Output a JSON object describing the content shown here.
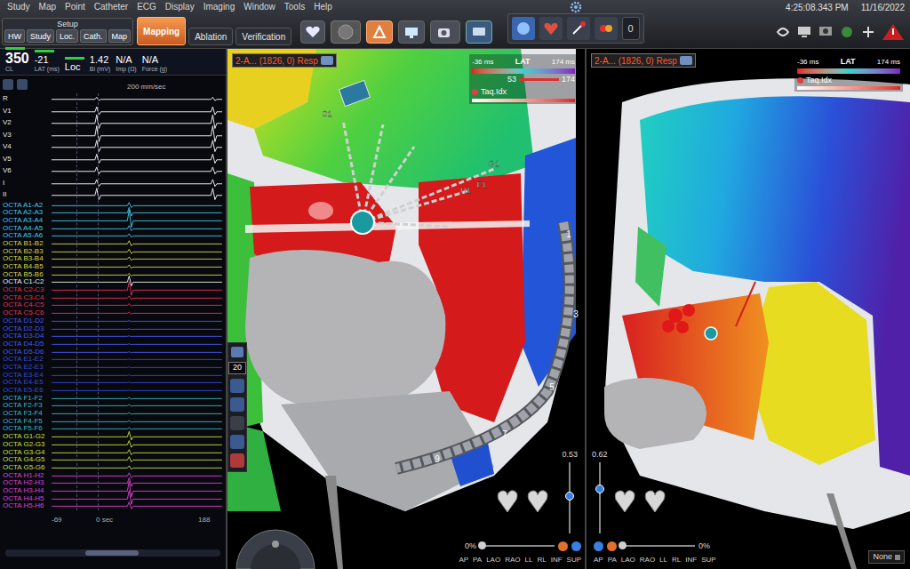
{
  "menu": [
    "Study",
    "Map",
    "Point",
    "Catheter",
    "ECG",
    "Display",
    "Imaging",
    "Window",
    "Tools",
    "Help"
  ],
  "setup": {
    "title": "Setup",
    "buttons": [
      "HW",
      "Study",
      "Loc.",
      "Cath.",
      "Map"
    ]
  },
  "workflow_tabs": [
    {
      "label": "Mapping",
      "selected": true
    },
    {
      "label": "Ablation",
      "selected": false
    },
    {
      "label": "Verification",
      "selected": false
    }
  ],
  "counter": "0",
  "clock": {
    "time": "4:25:08.343 PM",
    "date": "11/16/2022"
  },
  "readouts": [
    {
      "value": "350",
      "label": "CL",
      "indicator": true
    },
    {
      "value": "-21",
      "label": "LAT (ms)",
      "indicator": true
    },
    {
      "value": "Loc",
      "indicator": true
    },
    {
      "value": "1.42",
      "label": "Bi (mV)",
      "indicator": false
    },
    {
      "value": "N/A",
      "label": "Imp (Ω)",
      "indicator": false
    },
    {
      "value": "N/A",
      "label": "Force (g)",
      "indicator": false
    }
  ],
  "sweep": "200 mm/sec",
  "channels": [
    {
      "label": "R",
      "kind": "surface",
      "color": "#e8e8e8",
      "amplitude": 0.15
    },
    {
      "label": "V1",
      "kind": "surface",
      "color": "#e8e8e8",
      "amplitude": 0.35
    },
    {
      "label": "V2",
      "kind": "surface",
      "color": "#e8e8e8",
      "amplitude": 0.6
    },
    {
      "label": "V3",
      "kind": "surface",
      "color": "#e8e8e8",
      "amplitude": 0.7
    },
    {
      "label": "V4",
      "kind": "surface",
      "color": "#e8e8e8",
      "amplitude": 0.5
    },
    {
      "label": "V5",
      "kind": "surface",
      "color": "#e8e8e8",
      "amplitude": 0.4
    },
    {
      "label": "V6",
      "kind": "surface",
      "color": "#e8e8e8",
      "amplitude": 0.3
    },
    {
      "label": "I",
      "kind": "surface",
      "color": "#e8e8e8",
      "amplitude": 0.3
    },
    {
      "label": "II",
      "kind": "surface",
      "color": "#e8e8e8",
      "amplitude": 0.5
    },
    {
      "label": "OCTA A1-A2",
      "kind": "intracardiac",
      "color": "#45c8e8",
      "amplitude": 0.3
    },
    {
      "label": "OCTA A2-A3",
      "kind": "intracardiac",
      "color": "#45c8e8",
      "amplitude": 0.5
    },
    {
      "label": "OCTA A3-A4",
      "kind": "intracardiac",
      "color": "#45c8e8",
      "amplitude": 1.0
    },
    {
      "label": "OCTA A4-A5",
      "kind": "intracardiac",
      "color": "#45c8e8",
      "amplitude": 0.3
    },
    {
      "label": "OCTA A5-A6",
      "kind": "intracardiac",
      "color": "#45c8e8",
      "amplitude": 0.2
    },
    {
      "label": "OCTA B1-B2",
      "kind": "intracardiac",
      "color": "#d8d840",
      "amplitude": 0.3
    },
    {
      "label": "OCTA B2-B3",
      "kind": "intracardiac",
      "color": "#d8d840",
      "amplitude": 0.25
    },
    {
      "label": "OCTA B3-B4",
      "kind": "intracardiac",
      "color": "#d8d840",
      "amplitude": 0.2
    },
    {
      "label": "OCTA B4-B5",
      "kind": "intracardiac",
      "color": "#d8d840",
      "amplitude": 0.2
    },
    {
      "label": "OCTA B5-B6",
      "kind": "intracardiac",
      "color": "#d8d840",
      "amplitude": 0.15
    },
    {
      "label": "OCTA C1-C2",
      "kind": "intracardiac",
      "color": "#f0f0f0",
      "amplitude": 0.6
    },
    {
      "label": "OCTA C2-C3",
      "kind": "intracardiac",
      "color": "#e83050",
      "amplitude": 0.8
    },
    {
      "label": "OCTA C3-C4",
      "kind": "intracardiac",
      "color": "#e83050",
      "amplitude": 0.2
    },
    {
      "label": "OCTA C4-C5",
      "kind": "intracardiac",
      "color": "#e83050",
      "amplitude": 0.15
    },
    {
      "label": "OCTA C5-C6",
      "kind": "intracardiac",
      "color": "#e83050",
      "amplitude": 0.1
    },
    {
      "label": "OCTA D1-D2",
      "kind": "intracardiac",
      "color": "#4858f0",
      "amplitude": 0.05
    },
    {
      "label": "OCTA D2-D3",
      "kind": "intracardiac",
      "color": "#4858f0",
      "amplitude": 0.05
    },
    {
      "label": "OCTA D3-D4",
      "kind": "intracardiac",
      "color": "#4858f0",
      "amplitude": 0.05
    },
    {
      "label": "OCTA D4-D5",
      "kind": "intracardiac",
      "color": "#4858f0",
      "amplitude": 0.05
    },
    {
      "label": "OCTA D5-D6",
      "kind": "intracardiac",
      "color": "#4858f0",
      "amplitude": 0.05
    },
    {
      "label": "OCTA E1-E2",
      "kind": "intracardiac",
      "color": "#3848d8",
      "amplitude": 0.05
    },
    {
      "label": "OCTA E2-E3",
      "kind": "intracardiac",
      "color": "#3848d8",
      "amplitude": 0.05
    },
    {
      "label": "OCTA E3-E4",
      "kind": "intracardiac",
      "color": "#3848d8",
      "amplitude": 0.05
    },
    {
      "label": "OCTA E4-E5",
      "kind": "intracardiac",
      "color": "#3848d8",
      "amplitude": 0.05
    },
    {
      "label": "OCTA E5-E6",
      "kind": "intracardiac",
      "color": "#3848d8",
      "amplitude": 0.05
    },
    {
      "label": "OCTA F1-F2",
      "kind": "intracardiac",
      "color": "#3fb8c8",
      "amplitude": 0.1
    },
    {
      "label": "OCTA F2-F3",
      "kind": "intracardiac",
      "color": "#3fb8c8",
      "amplitude": 0.1
    },
    {
      "label": "OCTA F3-F4",
      "kind": "intracardiac",
      "color": "#3fb8c8",
      "amplitude": 0.1
    },
    {
      "label": "OCTA F4-F5",
      "kind": "intracardiac",
      "color": "#3fb8c8",
      "amplitude": 0.1
    },
    {
      "label": "OCTA F5-F6",
      "kind": "intracardiac",
      "color": "#3fb8c8",
      "amplitude": 0.1
    },
    {
      "label": "OCTA G1-G2",
      "kind": "intracardiac",
      "color": "#c8e040",
      "amplitude": 0.5
    },
    {
      "label": "OCTA G2-G3",
      "kind": "intracardiac",
      "color": "#c8e040",
      "amplitude": 0.4
    },
    {
      "label": "OCTA G3-G4",
      "kind": "intracardiac",
      "color": "#c8e040",
      "amplitude": 0.3
    },
    {
      "label": "OCTA G4-G5",
      "kind": "intracardiac",
      "color": "#c8e040",
      "amplitude": 0.3
    },
    {
      "label": "OCTA G5-G6",
      "kind": "intracardiac",
      "color": "#c8e040",
      "amplitude": 0.2
    },
    {
      "label": "OCTA H1-H2",
      "kind": "intracardiac",
      "color": "#e040d0",
      "amplitude": 0.3
    },
    {
      "label": "OCTA H2-H3",
      "kind": "intracardiac",
      "color": "#e040d0",
      "amplitude": 0.5
    },
    {
      "label": "OCTA H3-H4",
      "kind": "intracardiac",
      "color": "#e040d0",
      "amplitude": 0.9
    },
    {
      "label": "OCTA H4-H5",
      "kind": "intracardiac",
      "color": "#e040d0",
      "amplitude": 0.8
    },
    {
      "label": "OCTA H5-H6",
      "kind": "intracardiac",
      "color": "#e040d0",
      "amplitude": 0.4
    }
  ],
  "time_axis": {
    "start": "-69",
    "zero": "0 sec",
    "end": "188"
  },
  "tool_strip": {
    "value": "20"
  },
  "maps": [
    {
      "title": "2-A... (1826, 0) Resp",
      "legend": {
        "name": "LAT",
        "min": "-36 ms",
        "max": "174 ms",
        "window": [
          "53",
          "174"
        ]
      },
      "tag": "Taq.Idx",
      "slider": {
        "reading": "0.53",
        "level": 0.53
      },
      "transparency": {
        "reading": "0%",
        "level": 0
      },
      "views": [
        "AP",
        "PA",
        "LAO",
        "RAO",
        "LL",
        "RL",
        "INF",
        "SUP"
      ]
    },
    {
      "title": "2-A... (1826, 0) Resp",
      "legend": {
        "name": "LAT",
        "min": "-36 ms",
        "max": "174 ms",
        "window": []
      },
      "tag": "Taq.Idx",
      "slider": {
        "reading": "0.62",
        "level": 0.62
      },
      "transparency": {
        "reading": "0%",
        "level": 0
      },
      "views": [
        "AP",
        "PA",
        "LAO",
        "RAO",
        "LL",
        "RL",
        "INF",
        "SUP"
      ],
      "dropdown": "None"
    }
  ],
  "catheter_labels": [
    "1",
    "3",
    "5",
    "7",
    "9"
  ],
  "spline_labels": [
    "S1",
    "G1",
    "H1",
    "F1"
  ]
}
